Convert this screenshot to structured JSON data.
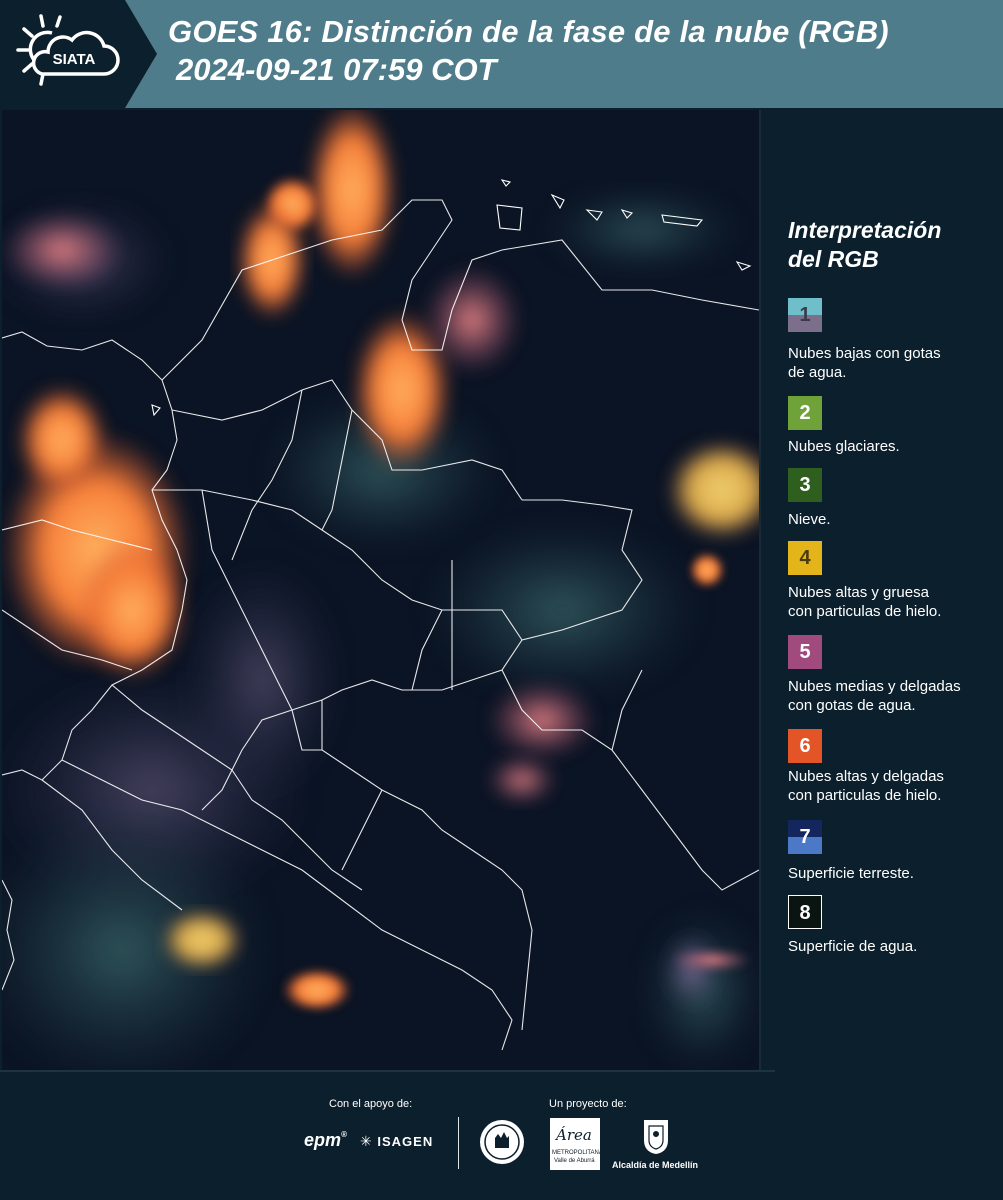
{
  "header": {
    "logo_text": "SIATA",
    "title_line1": "GOES 16: Distinción de la fase de la nube (RGB)",
    "title_line2": "2024-09-21 07:59 COT"
  },
  "legend": {
    "title_line1": "Interpretación",
    "title_line2": "del RGB",
    "items": [
      {
        "number": "1",
        "label_line1": "Nubes bajas con gotas",
        "label_line2": "de agua.",
        "color_top": "#6fbfca",
        "color_bottom": "#7b6f8b",
        "text_color": "#3b3b50"
      },
      {
        "number": "2",
        "label_line1": "Nubes glaciares.",
        "label_line2": "",
        "color_top": "#6fa33a",
        "color_bottom": "#6fa33a",
        "text_color": "#ffffff"
      },
      {
        "number": "3",
        "label_line1": "Nieve.",
        "label_line2": "",
        "color_top": "#2e5f1e",
        "color_bottom": "#2e5f1e",
        "text_color": "#ffffff"
      },
      {
        "number": "4",
        "label_line1": "Nubes altas y gruesa",
        "label_line2": "con particulas de hielo.",
        "color_top": "#e3b51a",
        "color_bottom": "#e3b51a",
        "text_color": "#4a3a10"
      },
      {
        "number": "5",
        "label_line1": "Nubes medias y delgadas",
        "label_line2": "con gotas de agua.",
        "color_top": "#a04a7e",
        "color_bottom": "#a04a7e",
        "text_color": "#ffffff"
      },
      {
        "number": "6",
        "label_line1": "Nubes altas y delgadas",
        "label_line2": "con particulas de hielo.",
        "color_top": "#e35426",
        "color_bottom": "#e35426",
        "text_color": "#ffffff"
      },
      {
        "number": "7",
        "label_line1": "Superficie terreste.",
        "label_line2": "",
        "color_top": "#14265e",
        "color_bottom": "#4c78c8",
        "text_color": "#ffffff"
      },
      {
        "number": "8",
        "label_line1": "Superficie de agua.",
        "label_line2": "",
        "color_top": "#0a1410",
        "color_bottom": "#0a1410",
        "text_color": "#ffffff"
      }
    ]
  },
  "footer": {
    "support_label": "Con el apoyo de:",
    "project_label": "Un proyecto de:",
    "brand_epm": "epm",
    "brand_isagen": "ISAGEN",
    "brand_area_line1": "METROPOLITANA",
    "brand_area_line2": "Valle de Aburrá",
    "brand_area_script": "Área",
    "brand_alcaldia": "Alcaldía de Medellín"
  }
}
